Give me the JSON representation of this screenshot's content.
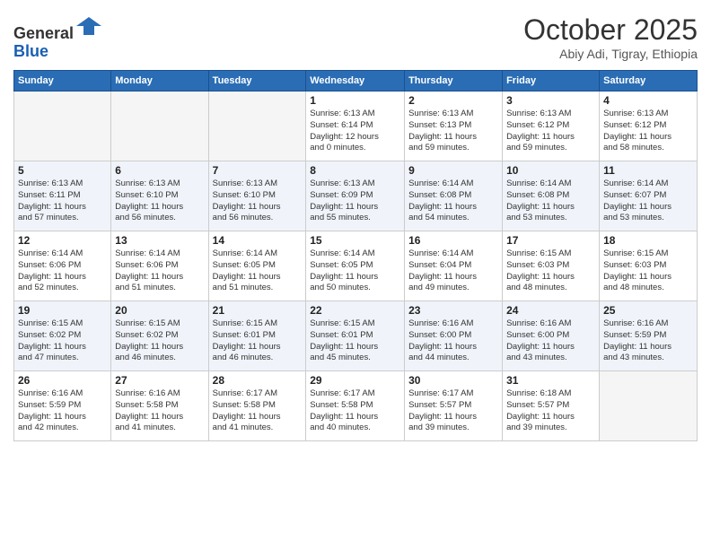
{
  "header": {
    "logo_line1": "General",
    "logo_line2": "Blue",
    "month": "October 2025",
    "location": "Abiy Adi, Tigray, Ethiopia"
  },
  "weekdays": [
    "Sunday",
    "Monday",
    "Tuesday",
    "Wednesday",
    "Thursday",
    "Friday",
    "Saturday"
  ],
  "weeks": [
    [
      {
        "day": "",
        "info": ""
      },
      {
        "day": "",
        "info": ""
      },
      {
        "day": "",
        "info": ""
      },
      {
        "day": "1",
        "info": "Sunrise: 6:13 AM\nSunset: 6:14 PM\nDaylight: 12 hours\nand 0 minutes."
      },
      {
        "day": "2",
        "info": "Sunrise: 6:13 AM\nSunset: 6:13 PM\nDaylight: 11 hours\nand 59 minutes."
      },
      {
        "day": "3",
        "info": "Sunrise: 6:13 AM\nSunset: 6:12 PM\nDaylight: 11 hours\nand 59 minutes."
      },
      {
        "day": "4",
        "info": "Sunrise: 6:13 AM\nSunset: 6:12 PM\nDaylight: 11 hours\nand 58 minutes."
      }
    ],
    [
      {
        "day": "5",
        "info": "Sunrise: 6:13 AM\nSunset: 6:11 PM\nDaylight: 11 hours\nand 57 minutes."
      },
      {
        "day": "6",
        "info": "Sunrise: 6:13 AM\nSunset: 6:10 PM\nDaylight: 11 hours\nand 56 minutes."
      },
      {
        "day": "7",
        "info": "Sunrise: 6:13 AM\nSunset: 6:10 PM\nDaylight: 11 hours\nand 56 minutes."
      },
      {
        "day": "8",
        "info": "Sunrise: 6:13 AM\nSunset: 6:09 PM\nDaylight: 11 hours\nand 55 minutes."
      },
      {
        "day": "9",
        "info": "Sunrise: 6:14 AM\nSunset: 6:08 PM\nDaylight: 11 hours\nand 54 minutes."
      },
      {
        "day": "10",
        "info": "Sunrise: 6:14 AM\nSunset: 6:08 PM\nDaylight: 11 hours\nand 53 minutes."
      },
      {
        "day": "11",
        "info": "Sunrise: 6:14 AM\nSunset: 6:07 PM\nDaylight: 11 hours\nand 53 minutes."
      }
    ],
    [
      {
        "day": "12",
        "info": "Sunrise: 6:14 AM\nSunset: 6:06 PM\nDaylight: 11 hours\nand 52 minutes."
      },
      {
        "day": "13",
        "info": "Sunrise: 6:14 AM\nSunset: 6:06 PM\nDaylight: 11 hours\nand 51 minutes."
      },
      {
        "day": "14",
        "info": "Sunrise: 6:14 AM\nSunset: 6:05 PM\nDaylight: 11 hours\nand 51 minutes."
      },
      {
        "day": "15",
        "info": "Sunrise: 6:14 AM\nSunset: 6:05 PM\nDaylight: 11 hours\nand 50 minutes."
      },
      {
        "day": "16",
        "info": "Sunrise: 6:14 AM\nSunset: 6:04 PM\nDaylight: 11 hours\nand 49 minutes."
      },
      {
        "day": "17",
        "info": "Sunrise: 6:15 AM\nSunset: 6:03 PM\nDaylight: 11 hours\nand 48 minutes."
      },
      {
        "day": "18",
        "info": "Sunrise: 6:15 AM\nSunset: 6:03 PM\nDaylight: 11 hours\nand 48 minutes."
      }
    ],
    [
      {
        "day": "19",
        "info": "Sunrise: 6:15 AM\nSunset: 6:02 PM\nDaylight: 11 hours\nand 47 minutes."
      },
      {
        "day": "20",
        "info": "Sunrise: 6:15 AM\nSunset: 6:02 PM\nDaylight: 11 hours\nand 46 minutes."
      },
      {
        "day": "21",
        "info": "Sunrise: 6:15 AM\nSunset: 6:01 PM\nDaylight: 11 hours\nand 46 minutes."
      },
      {
        "day": "22",
        "info": "Sunrise: 6:15 AM\nSunset: 6:01 PM\nDaylight: 11 hours\nand 45 minutes."
      },
      {
        "day": "23",
        "info": "Sunrise: 6:16 AM\nSunset: 6:00 PM\nDaylight: 11 hours\nand 44 minutes."
      },
      {
        "day": "24",
        "info": "Sunrise: 6:16 AM\nSunset: 6:00 PM\nDaylight: 11 hours\nand 43 minutes."
      },
      {
        "day": "25",
        "info": "Sunrise: 6:16 AM\nSunset: 5:59 PM\nDaylight: 11 hours\nand 43 minutes."
      }
    ],
    [
      {
        "day": "26",
        "info": "Sunrise: 6:16 AM\nSunset: 5:59 PM\nDaylight: 11 hours\nand 42 minutes."
      },
      {
        "day": "27",
        "info": "Sunrise: 6:16 AM\nSunset: 5:58 PM\nDaylight: 11 hours\nand 41 minutes."
      },
      {
        "day": "28",
        "info": "Sunrise: 6:17 AM\nSunset: 5:58 PM\nDaylight: 11 hours\nand 41 minutes."
      },
      {
        "day": "29",
        "info": "Sunrise: 6:17 AM\nSunset: 5:58 PM\nDaylight: 11 hours\nand 40 minutes."
      },
      {
        "day": "30",
        "info": "Sunrise: 6:17 AM\nSunset: 5:57 PM\nDaylight: 11 hours\nand 39 minutes."
      },
      {
        "day": "31",
        "info": "Sunrise: 6:18 AM\nSunset: 5:57 PM\nDaylight: 11 hours\nand 39 minutes."
      },
      {
        "day": "",
        "info": ""
      }
    ]
  ]
}
